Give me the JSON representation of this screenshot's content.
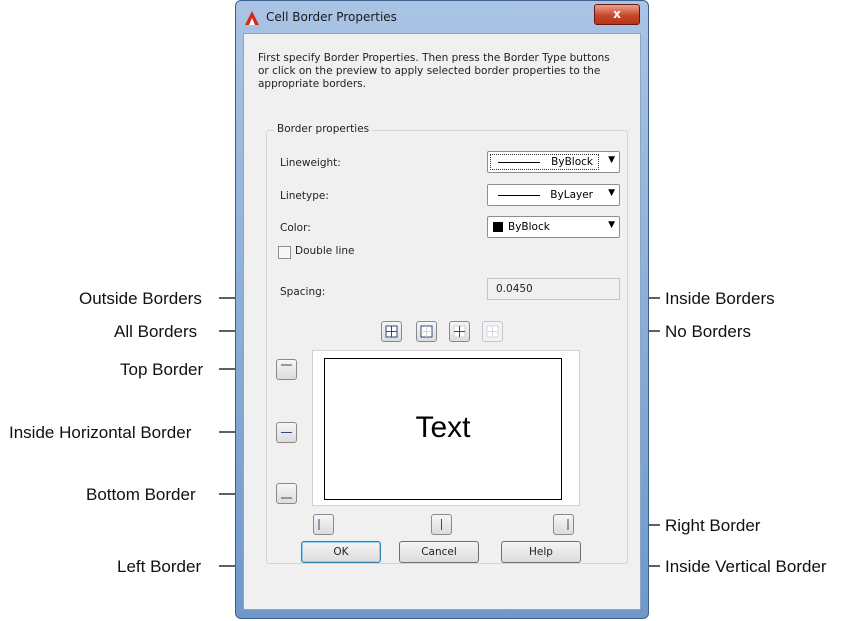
{
  "dialog": {
    "title": "Cell Border Properties",
    "close_label": "x",
    "description": "First specify Border Properties. Then press the Border Type buttons or click on the preview to apply selected border properties to the appropriate borders."
  },
  "border_properties": {
    "group_title": "Border properties",
    "lineweight": {
      "label": "Lineweight:",
      "value": "ByBlock"
    },
    "linetype": {
      "label": "Linetype:",
      "value": "ByLayer"
    },
    "color": {
      "label": "Color:",
      "value": "ByBlock",
      "swatch": "#000000"
    },
    "double_line": {
      "label": "Double line",
      "checked": false
    },
    "spacing": {
      "label": "Spacing:",
      "value": "0.0450"
    }
  },
  "preview": {
    "text": "Text"
  },
  "buttons": {
    "ok": "OK",
    "cancel": "Cancel",
    "help": "Help"
  },
  "callouts": {
    "outside_borders": "Outside Borders",
    "all_borders": "All Borders",
    "top_border": "Top Border",
    "inside_horizontal_border": "Inside Horizontal Border",
    "bottom_border": "Bottom Border",
    "left_border": "Left Border",
    "inside_borders": "Inside Borders",
    "no_borders": "No Borders",
    "right_border": "Right Border",
    "inside_vertical_border": "Inside Vertical Border"
  },
  "icons": {
    "app": "autocad-a-icon",
    "dropdown": "chevron-down-icon"
  }
}
